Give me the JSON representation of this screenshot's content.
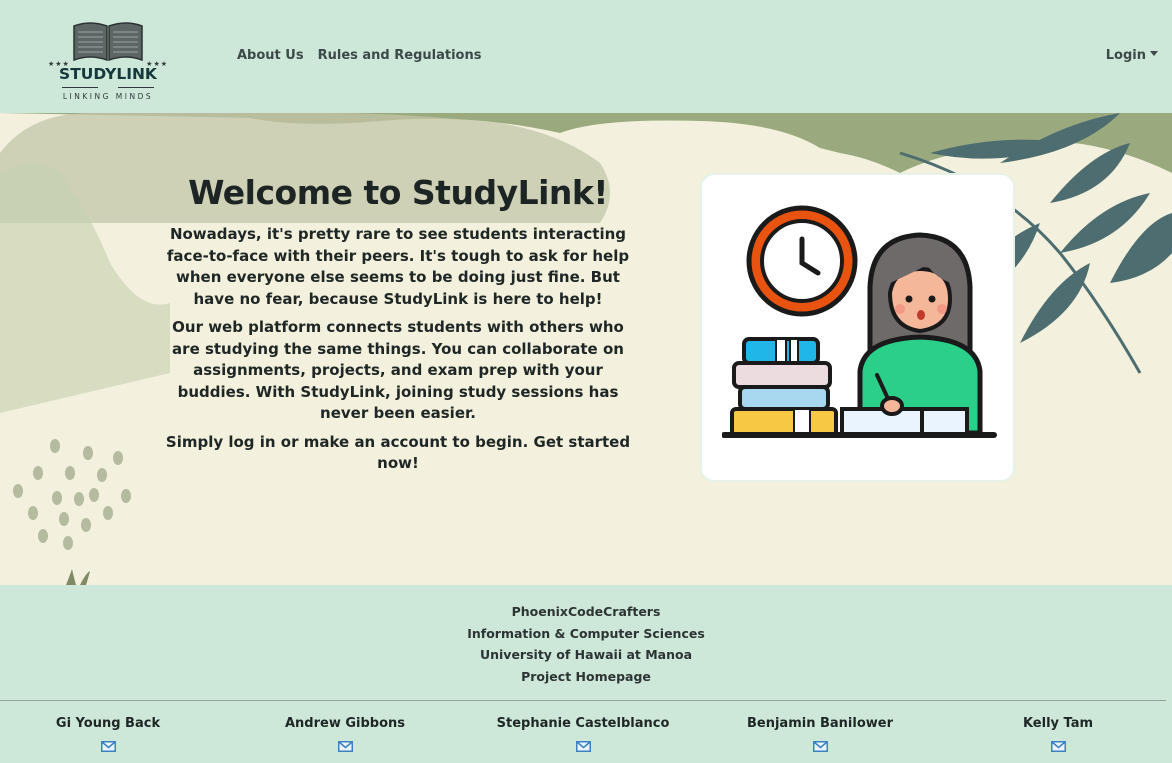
{
  "navbar": {
    "logo": {
      "name": "STUDYLINK",
      "tagline": "LINKING MINDS"
    },
    "links": [
      {
        "label": "About Us"
      },
      {
        "label": "Rules and Regulations"
      }
    ],
    "login_label": "Login"
  },
  "hero": {
    "title": "Welcome to StudyLink!",
    "paragraphs": [
      "Nowadays, it's pretty rare to see students interacting face-to-face with their peers. It's tough to ask for help when everyone else seems to be doing just fine. But have no fear, because StudyLink is here to help!",
      "Our web platform connects students with others who are studying the same things. You can collaborate on assignments, projects, and exam prep with your buddies. With StudyLink, joining study sessions has never been easier.",
      "Simply log in or make an account to begin. Get started now!"
    ],
    "illustration_icon": "student-studying-illustration"
  },
  "footer": {
    "lines": [
      "PhoenixCodeCrafters",
      "Information & Computer Sciences",
      "University of Hawaii at Manoa",
      "Project Homepage"
    ],
    "members": [
      {
        "name": "Gi Young Back",
        "icon": "mail-icon"
      },
      {
        "name": "Andrew Gibbons",
        "icon": "mail-icon"
      },
      {
        "name": "Stephanie Castelblanco",
        "icon": "mail-icon"
      },
      {
        "name": "Benjamin Banilower",
        "icon": "mail-icon"
      },
      {
        "name": "Kelly Tam",
        "icon": "mail-icon"
      }
    ]
  },
  "colors": {
    "navbar_bg": "#cde8d8",
    "hero_bg": "#f3f1dd",
    "blob_green": "#9aa97e",
    "leaf_teal": "#4d6d70",
    "mail_blue": "#3b82c4"
  }
}
